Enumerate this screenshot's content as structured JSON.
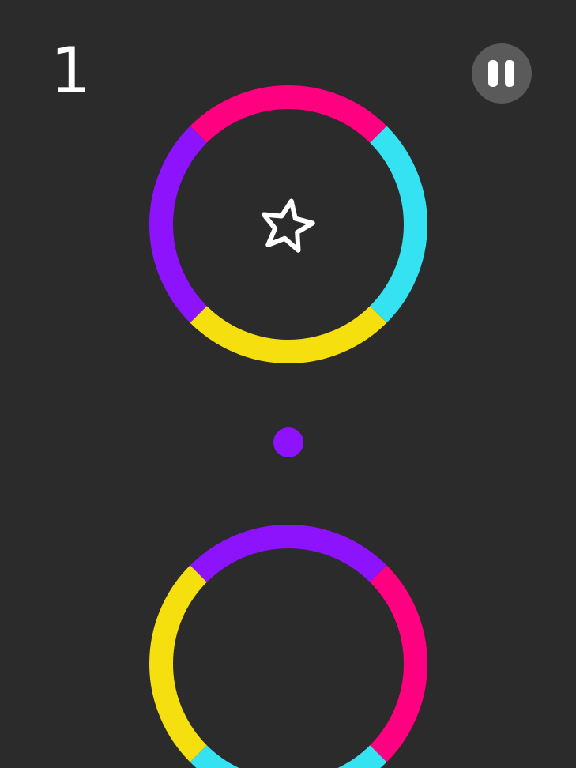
{
  "hud": {
    "score": "1",
    "pause_icon": "pause-icon"
  },
  "colors": {
    "background": "#2b2b2b",
    "pink": "#ff0080",
    "cyan": "#35e2f2",
    "yellow": "#f6df0e",
    "purple": "#8c13fb",
    "star": "#ffffff",
    "pause_button": "#5a5a5a"
  },
  "rings": [
    {
      "name": "ring-top",
      "segments": [
        "pink",
        "cyan",
        "yellow",
        "purple"
      ]
    },
    {
      "name": "ring-bottom",
      "segments": [
        "purple",
        "pink",
        "cyan",
        "yellow"
      ]
    }
  ],
  "player": {
    "color": "purple"
  },
  "star": {
    "icon": "star-icon"
  }
}
